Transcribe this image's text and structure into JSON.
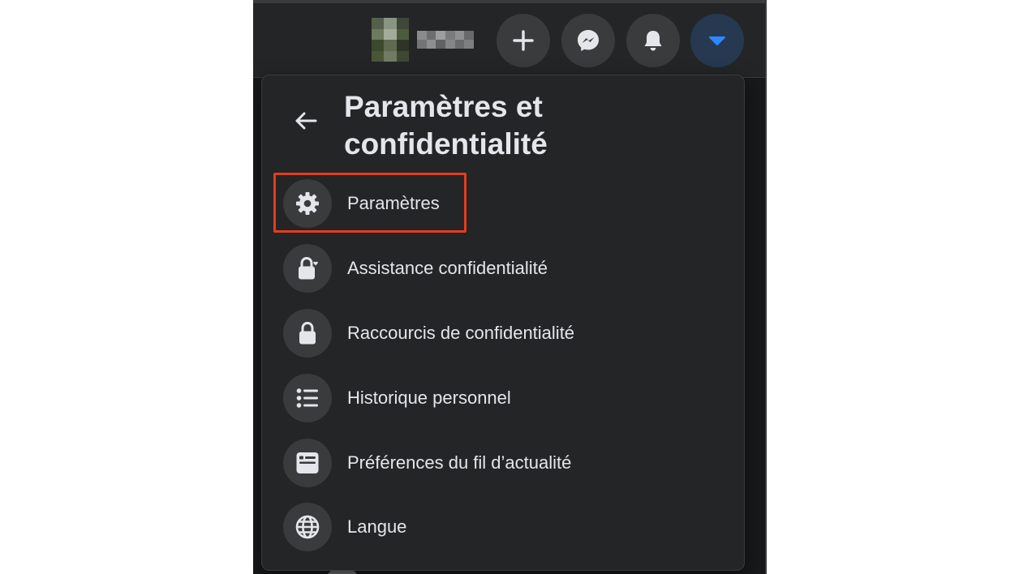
{
  "menu": {
    "title": "Paramètres et confidentialité",
    "items": [
      {
        "label": "Paramètres",
        "icon": "gear-icon",
        "highlighted": true
      },
      {
        "label": "Assistance confidentialité",
        "icon": "lock-heart-icon"
      },
      {
        "label": "Raccourcis de confidentialité",
        "icon": "lock-icon"
      },
      {
        "label": "Historique personnel",
        "icon": "list-icon"
      },
      {
        "label": "Préférences du fil d’actualité",
        "icon": "news-feed-icon"
      },
      {
        "label": "Langue",
        "icon": "globe-icon"
      }
    ]
  },
  "topbar": {
    "buttons": [
      "plus-icon",
      "messenger-icon",
      "bell-icon",
      "caret-down-icon"
    ]
  },
  "colors": {
    "background": "#18191a",
    "surface": "#242526",
    "button": "#3a3b3c",
    "text": "#e4e6eb",
    "accent": "#2d88ff",
    "highlight": "#e33c1f"
  }
}
